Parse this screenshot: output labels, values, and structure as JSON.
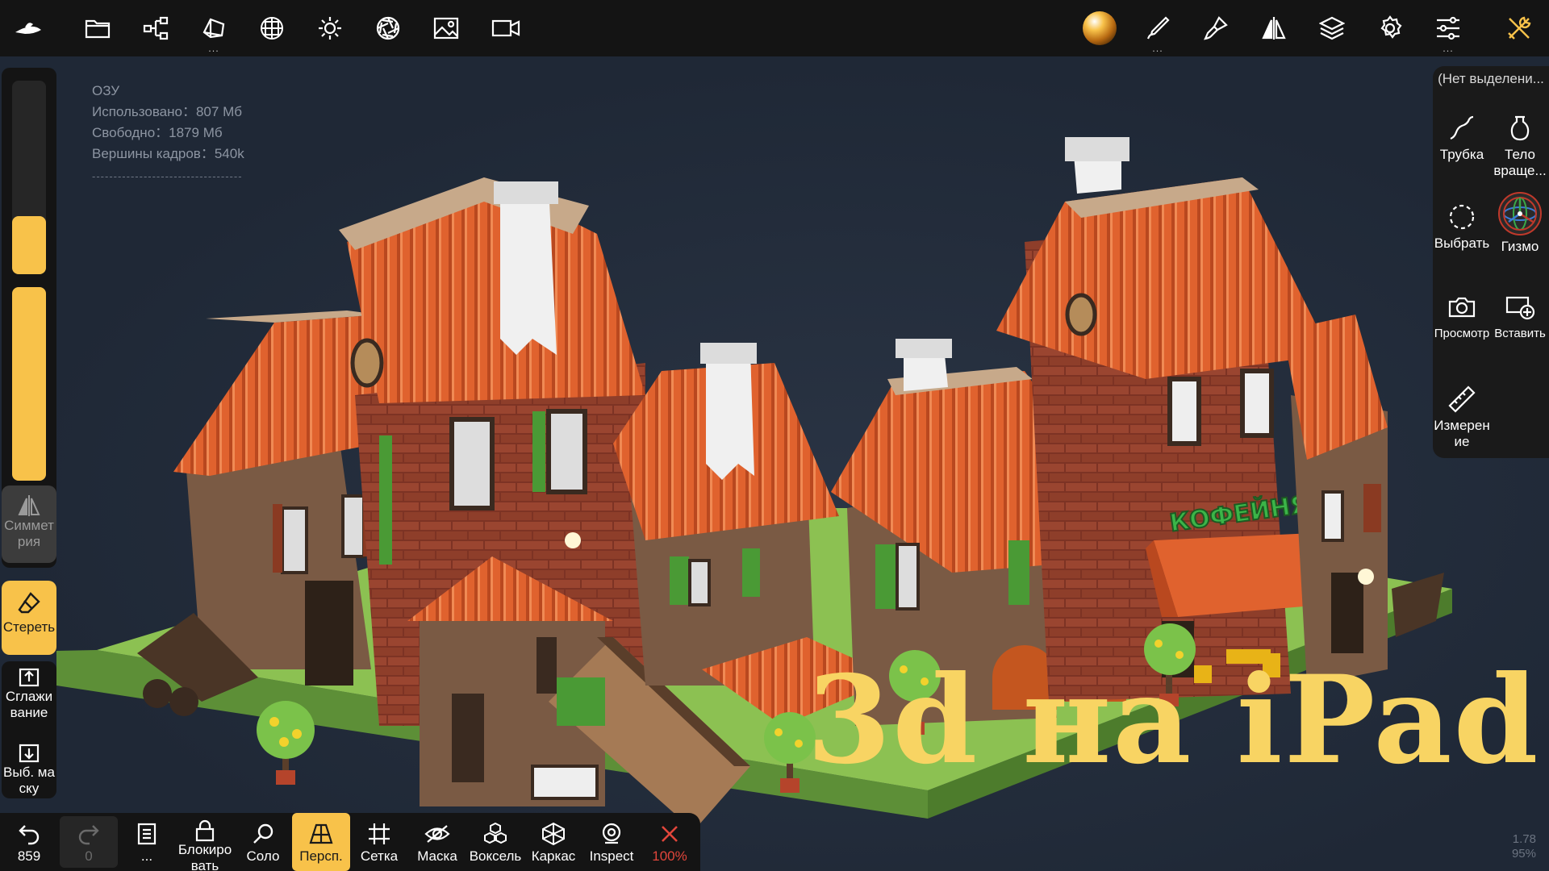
{
  "stats": {
    "title": "ОЗУ",
    "used": "Использовано：807 Мб",
    "free": "Свободно：1879 Мб",
    "vertices": "Вершины кадров：540k",
    "separator": "-----------------------------------"
  },
  "top_toolbar": {
    "left_icons": [
      "app-logo-icon",
      "folder-icon",
      "scene-graph-icon",
      "topology-icon",
      "material-sphere-icon",
      "light-icon",
      "render-aperture-icon",
      "image-icon",
      "video-icon"
    ],
    "right_icons": [
      "matcap-ball-icon",
      "brush-icon",
      "paint-brush-icon",
      "symmetry-icon",
      "layers-icon",
      "settings-icon",
      "sliders-icon",
      "tools-icon"
    ],
    "more_indicator": "...",
    "accent": "#f8c24a"
  },
  "left_panel": {
    "slider1_level": 0.3,
    "slider2_level": 1.0,
    "symmetry_label": "Симметрия",
    "erase_label": "Стереть",
    "smooth_label": "Сглаживание",
    "mask_label": "Выб. маску",
    "accent": "#f8c24a"
  },
  "right_panel": {
    "title": "(Нет выделени...",
    "items": [
      {
        "name": "tube",
        "label": "Трубка",
        "icon": "tube-curve-icon"
      },
      {
        "name": "lathe",
        "label": "Тело враще...",
        "icon": "lathe-vase-icon"
      },
      {
        "name": "select",
        "label": "Выбрать",
        "icon": "select-lasso-icon"
      },
      {
        "name": "gizmo",
        "label": "Гизмо",
        "icon": "gizmo-icon"
      },
      {
        "name": "view",
        "label": "Просмотр",
        "icon": "camera-icon"
      },
      {
        "name": "insert",
        "label": "Вставить",
        "icon": "insert-add-icon"
      },
      {
        "name": "measure",
        "label": "Измерение",
        "icon": "ruler-icon"
      }
    ]
  },
  "bottom_bar": {
    "undo_count": "859",
    "redo_count": "0",
    "history_label": "...",
    "lock_label": "Блокировать",
    "solo_label": "Соло",
    "persp_label": "Персп.",
    "grid_label": "Сетка",
    "mask_label": "Маска",
    "voxel_label": "Воксель",
    "wire_label": "Каркас",
    "inspect_label": "Inspect",
    "zoom_label": "100%",
    "active_color": "#f8c24a",
    "close_color": "#e2463b"
  },
  "scene": {
    "sign_text": "КОФЕЙНЯ",
    "overlay_title": "3d на iPad",
    "colors": {
      "roof": "#e0622e",
      "brick": "#8e3e2a",
      "wall": "#7a5a44",
      "grass": "#8cc152",
      "title": "#f8d463"
    }
  },
  "fps": {
    "frame_time": "1.78",
    "percent": "95%"
  }
}
